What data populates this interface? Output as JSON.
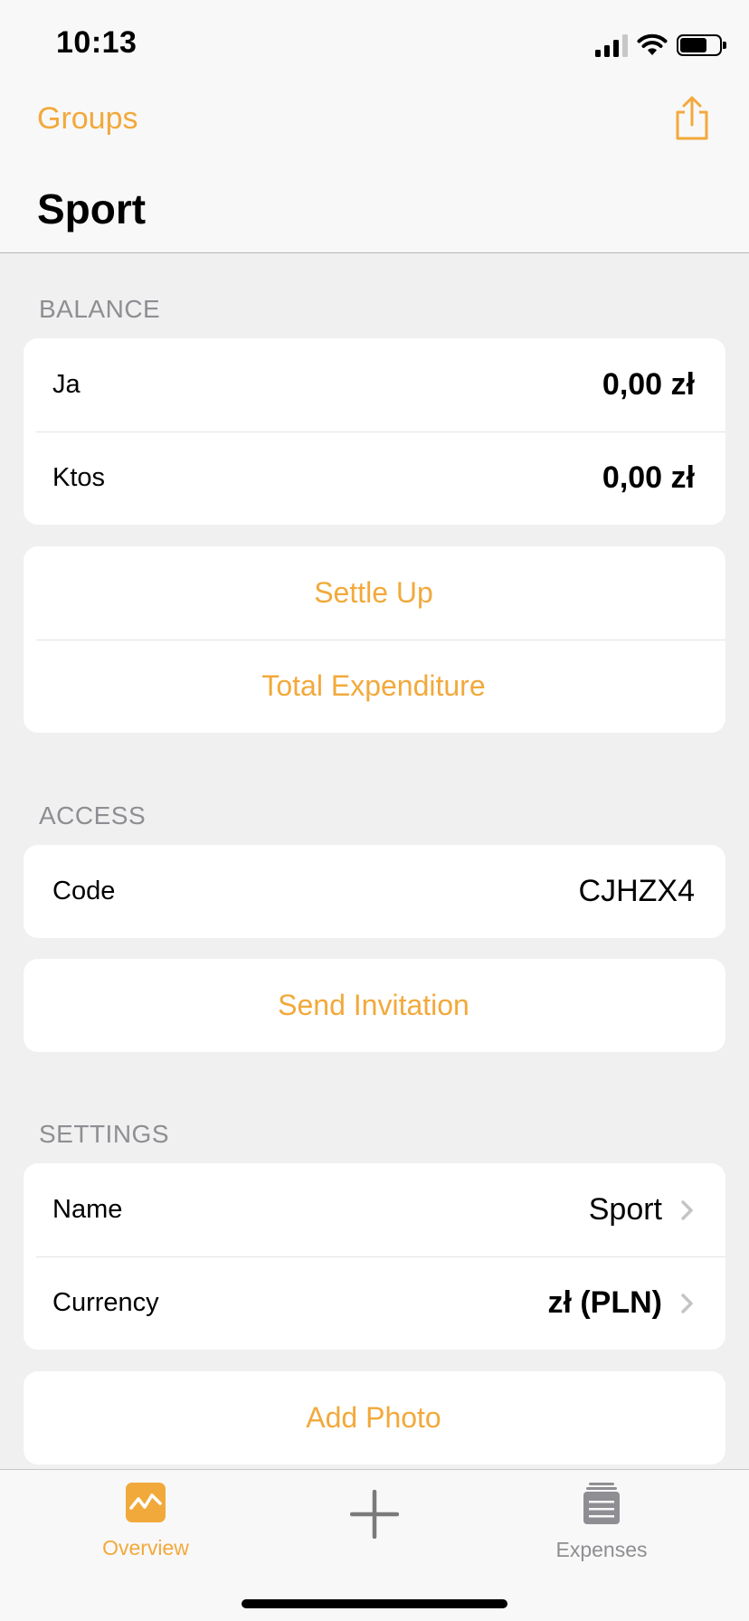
{
  "status": {
    "time": "10:13"
  },
  "nav": {
    "back_label": "Groups",
    "title": "Sport"
  },
  "balance": {
    "header": "BALANCE",
    "rows": [
      {
        "label": "Ja",
        "value": "0,00 zł"
      },
      {
        "label": "Ktos",
        "value": "0,00 zł"
      }
    ]
  },
  "actions": {
    "settle_up": "Settle Up",
    "total_expenditure": "Total Expenditure"
  },
  "access": {
    "header": "ACCESS",
    "code_label": "Code",
    "code_value": "CJHZX4",
    "send_invitation": "Send Invitation"
  },
  "settings": {
    "header": "SETTINGS",
    "name_label": "Name",
    "name_value": "Sport",
    "currency_label": "Currency",
    "currency_value": "zł (PLN)",
    "add_photo": "Add Photo"
  },
  "tabs": {
    "overview": "Overview",
    "expenses": "Expenses"
  },
  "colors": {
    "accent": "#f2a93b",
    "inactive": "#8e8e93"
  }
}
